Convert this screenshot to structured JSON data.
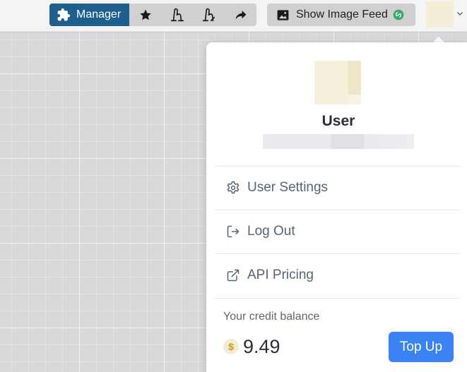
{
  "toolbar": {
    "manager_label": "Manager",
    "icons": [
      "star-icon",
      "snowflake-b-icon",
      "snowflake-c-icon",
      "share-arrow-icon"
    ],
    "feed_label": "Show Image Feed",
    "feed_icon": "image-icon",
    "feed_badge_icon": "link-badge-icon"
  },
  "user_menu": {
    "name": "User",
    "items": [
      {
        "label": "User Settings",
        "icon": "gear-icon"
      },
      {
        "label": "Log Out",
        "icon": "logout-icon"
      },
      {
        "label": "API Pricing",
        "icon": "external-link-icon"
      }
    ],
    "credit_label": "Your credit balance",
    "currency_symbol": "$",
    "balance": "9.49",
    "topup_label": "Top Up"
  },
  "colors": {
    "manager_bg": "#1e5f8f",
    "topup_bg": "#3b82f6",
    "badge_green": "#3aa76d",
    "coin": "#c99a1a"
  }
}
